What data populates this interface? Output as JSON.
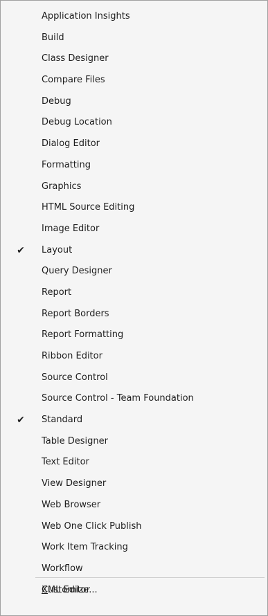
{
  "menu": {
    "items": [
      {
        "label": "Application Insights",
        "checked": false
      },
      {
        "label": "Build",
        "checked": false
      },
      {
        "label": "Class Designer",
        "checked": false
      },
      {
        "label": "Compare Files",
        "checked": false
      },
      {
        "label": "Debug",
        "checked": false
      },
      {
        "label": "Debug Location",
        "checked": false
      },
      {
        "label": "Dialog Editor",
        "checked": false
      },
      {
        "label": "Formatting",
        "checked": false
      },
      {
        "label": "Graphics",
        "checked": false
      },
      {
        "label": "HTML Source Editing",
        "checked": false
      },
      {
        "label": "Image Editor",
        "checked": false
      },
      {
        "label": "Layout",
        "checked": true
      },
      {
        "label": "Query Designer",
        "checked": false
      },
      {
        "label": "Report",
        "checked": false
      },
      {
        "label": "Report Borders",
        "checked": false
      },
      {
        "label": "Report Formatting",
        "checked": false
      },
      {
        "label": "Ribbon Editor",
        "checked": false
      },
      {
        "label": "Source Control",
        "checked": false
      },
      {
        "label": "Source Control - Team Foundation",
        "checked": false
      },
      {
        "label": "Standard",
        "checked": true
      },
      {
        "label": "Table Designer",
        "checked": false
      },
      {
        "label": "Text Editor",
        "checked": false
      },
      {
        "label": "View Designer",
        "checked": false
      },
      {
        "label": "Web Browser",
        "checked": false
      },
      {
        "label": "Web One Click Publish",
        "checked": false
      },
      {
        "label": "Work Item Tracking",
        "checked": false
      },
      {
        "label": "Workflow",
        "checked": false
      },
      {
        "label": "XML Editor",
        "checked": false
      }
    ],
    "check_glyph": "✔",
    "customize": {
      "mnemonic": "C",
      "rest": "ustomize..."
    }
  }
}
